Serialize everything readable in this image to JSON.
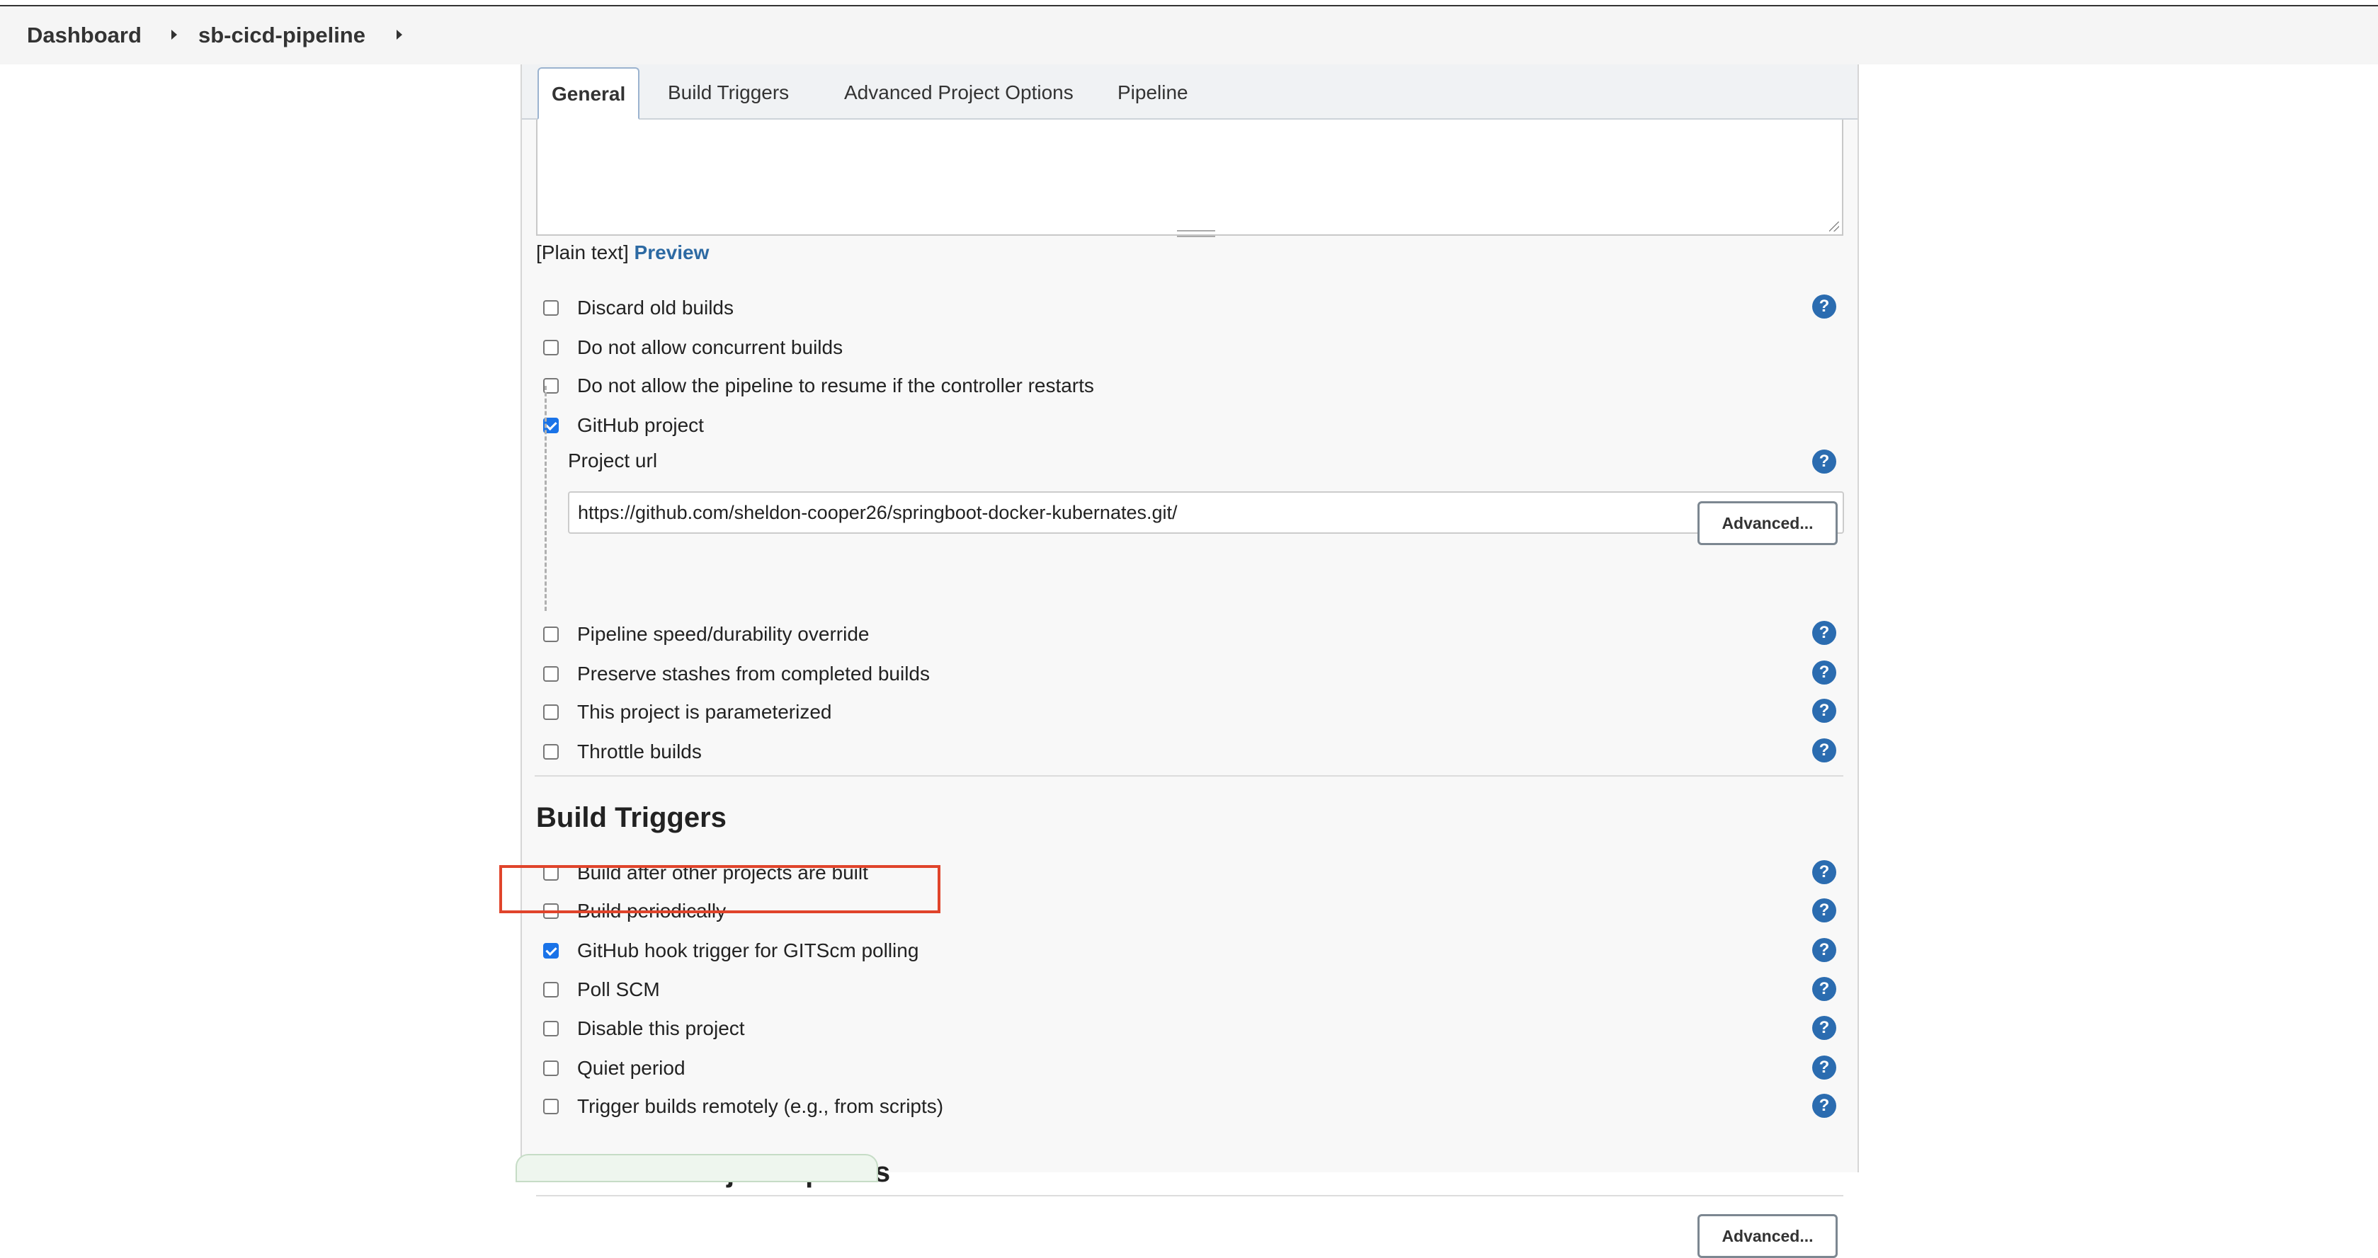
{
  "breadcrumb": {
    "items": [
      "Dashboard",
      "sb-cicd-pipeline"
    ]
  },
  "tabs": [
    {
      "label": "General",
      "active": true
    },
    {
      "label": "Build Triggers",
      "active": false
    },
    {
      "label": "Advanced Project Options",
      "active": false
    },
    {
      "label": "Pipeline",
      "active": false
    }
  ],
  "description": {
    "plain_text": "[Plain text]",
    "preview_label": "Preview"
  },
  "general": {
    "options": [
      {
        "label": "Discard old builds",
        "checked": false,
        "help": true
      },
      {
        "label": "Do not allow concurrent builds",
        "checked": false,
        "help": false
      },
      {
        "label": "Do not allow the pipeline to resume if the controller restarts",
        "checked": false,
        "help": false
      },
      {
        "label": "GitHub project",
        "checked": true,
        "help": false
      }
    ],
    "project_url_label": "Project url",
    "project_url_value": "https://github.com/sheldon-cooper26/springboot-docker-kubernates.git/",
    "advanced_label": "Advanced...",
    "more_options": [
      {
        "label": "Pipeline speed/durability override",
        "checked": false
      },
      {
        "label": "Preserve stashes from completed builds",
        "checked": false
      },
      {
        "label": "This project is parameterized",
        "checked": false
      },
      {
        "label": "Throttle builds",
        "checked": false
      }
    ]
  },
  "build_triggers": {
    "title": "Build Triggers",
    "options": [
      {
        "label": "Build after other projects are built",
        "checked": false
      },
      {
        "label": "Build periodically",
        "checked": false
      },
      {
        "label": "GitHub hook trigger for GITScm polling",
        "checked": true
      },
      {
        "label": "Poll SCM",
        "checked": false
      },
      {
        "label": "Disable this project",
        "checked": false
      },
      {
        "label": "Quiet period",
        "checked": false
      },
      {
        "label": "Trigger builds remotely (e.g., from scripts)",
        "checked": false
      }
    ]
  },
  "advanced_project_options": {
    "title": "Advanced Project Options",
    "advanced_label": "Advanced..."
  },
  "help_glyph": "?",
  "colors": {
    "accent": "#1a73e8",
    "help": "#2b6cb0",
    "highlight": "#e0442b",
    "link": "#2d6aa3"
  }
}
